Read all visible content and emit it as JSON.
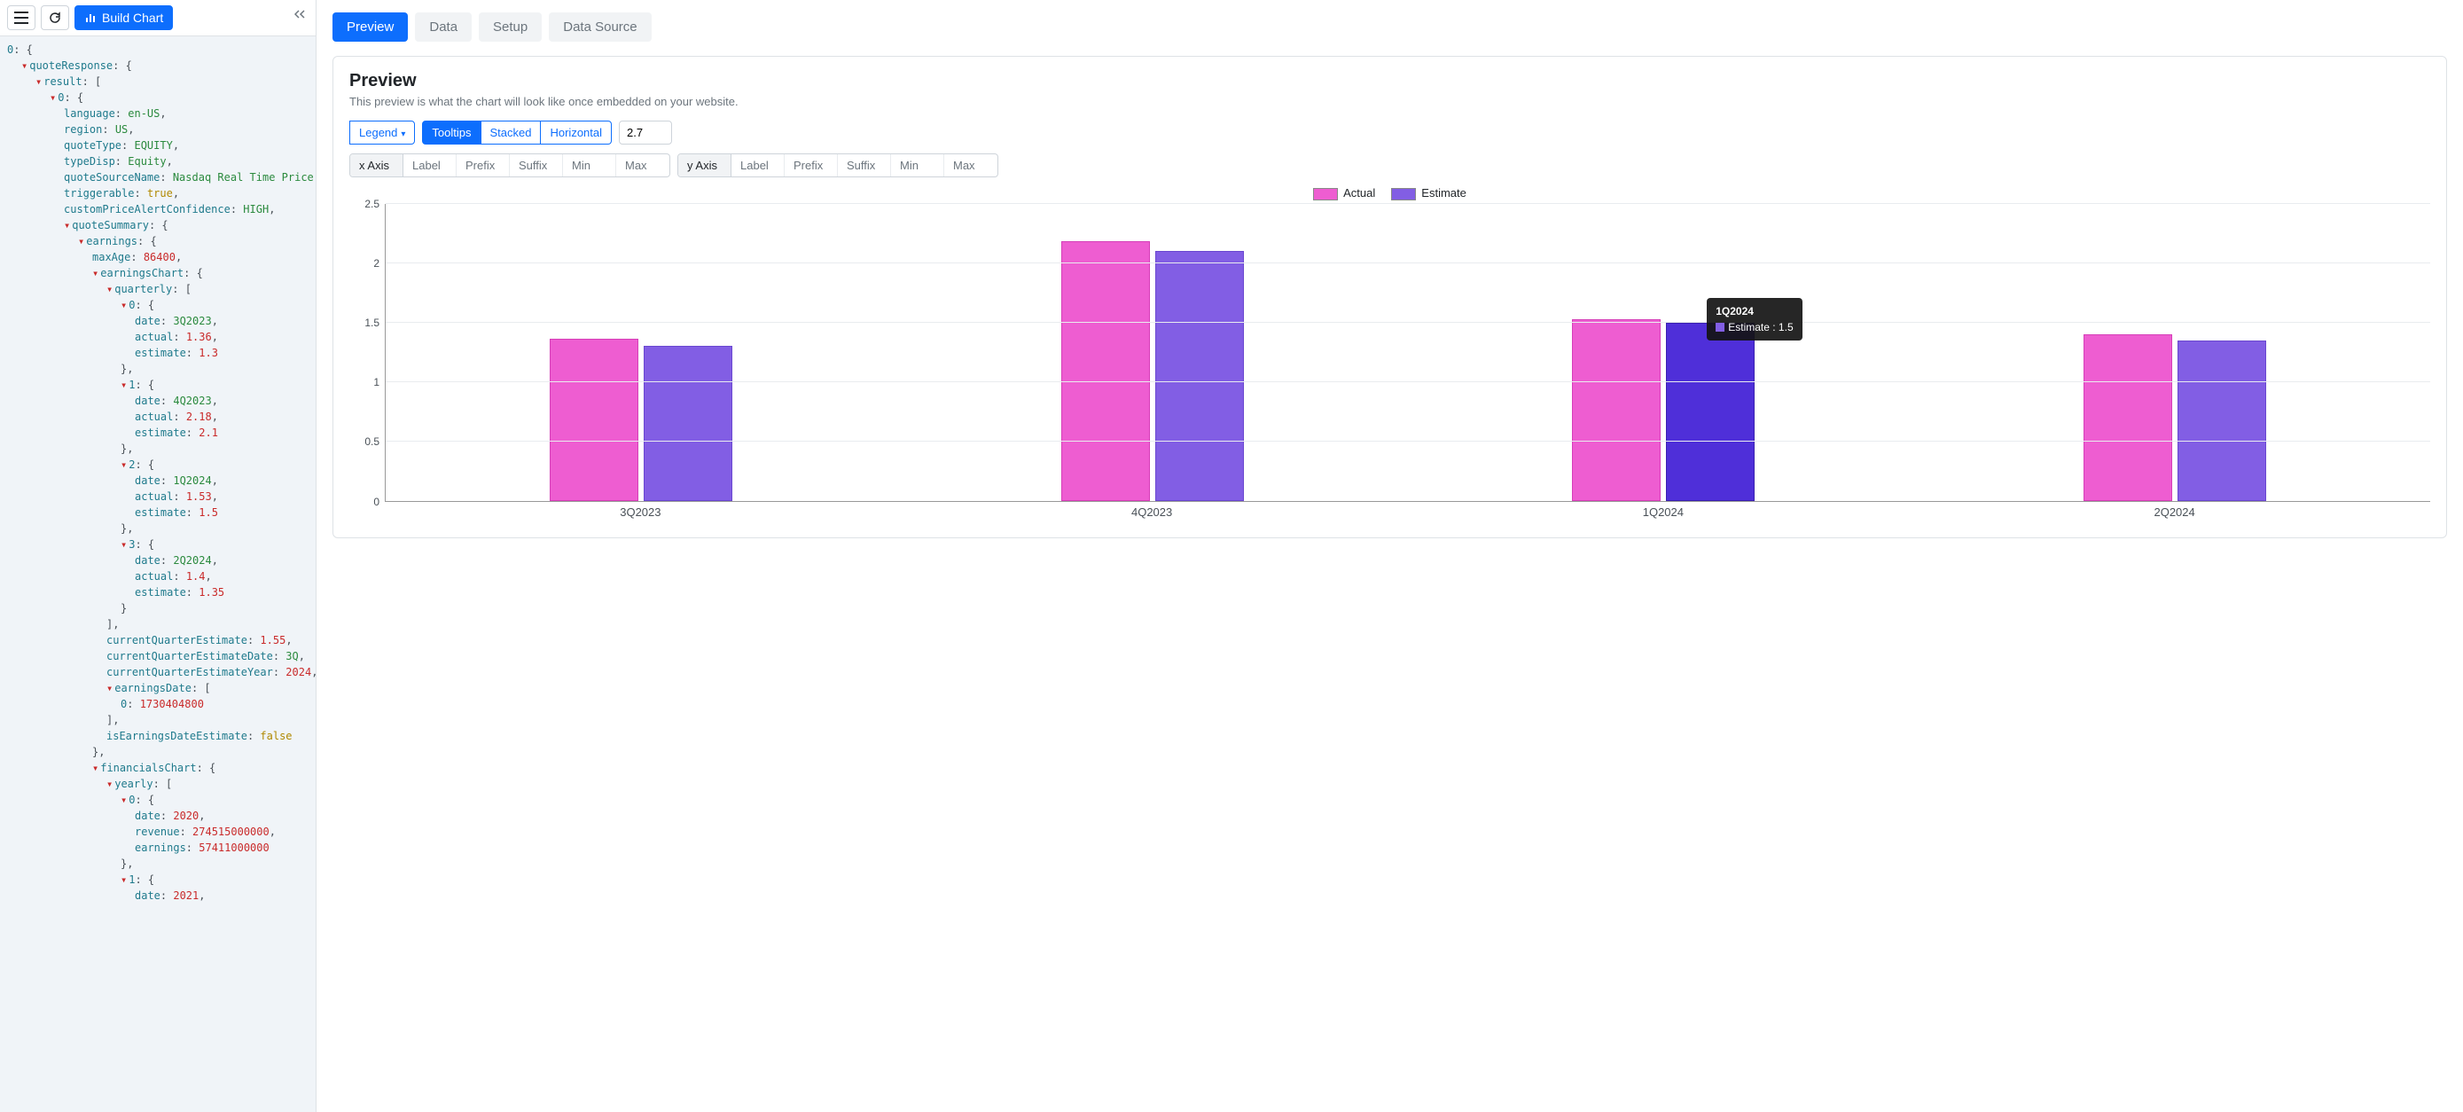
{
  "toolbar": {
    "build_label": "Build Chart"
  },
  "json_tree": {
    "quoteResponse": {
      "result0": {
        "language": "en-US",
        "region": "US",
        "quoteType": "EQUITY",
        "typeDisp": "Equity",
        "quoteSourceName": "Nasdaq Real Time Price",
        "triggerable": "true",
        "customPriceAlertConfidence": "HIGH",
        "quoteSummary": {
          "earnings": {
            "maxAge": "86400",
            "earningsChart": {
              "quarterly": [
                {
                  "date": "3Q2023",
                  "actual": "1.36",
                  "estimate": "1.3"
                },
                {
                  "date": "4Q2023",
                  "actual": "2.18",
                  "estimate": "2.1"
                },
                {
                  "date": "1Q2024",
                  "actual": "1.53",
                  "estimate": "1.5"
                },
                {
                  "date": "2Q2024",
                  "actual": "1.4",
                  "estimate": "1.35"
                }
              ],
              "currentQuarterEstimate": "1.55",
              "currentQuarterEstimateDate": "3Q",
              "currentQuarterEstimateYear": "2024",
              "earningsDate0": "1730404800",
              "isEarningsDateEstimate": "false"
            }
          },
          "financialsChart": {
            "yearly": [
              {
                "date": "2020",
                "revenue": "274515000000",
                "earnings": "57411000000"
              },
              {
                "date": "2021"
              }
            ]
          }
        }
      }
    }
  },
  "tabs": [
    "Preview",
    "Data",
    "Setup",
    "Data Source"
  ],
  "active_tab": 0,
  "preview": {
    "title": "Preview",
    "subtitle": "This preview is what the chart will look like once embedded on your website.",
    "legend_label": "Legend",
    "tooltips_label": "Tooltips",
    "stacked_label": "Stacked",
    "horizontal_label": "Horizontal",
    "ymax_input": "2.7",
    "axis_labels": {
      "xaxis": "x Axis",
      "yaxis": "y Axis",
      "label": "Label",
      "prefix": "Prefix",
      "suffix": "Suffix",
      "min": "Min",
      "max": "Max"
    }
  },
  "chart_data": {
    "type": "bar",
    "categories": [
      "3Q2023",
      "4Q2023",
      "1Q2024",
      "2Q2024"
    ],
    "series": [
      {
        "name": "Actual",
        "color": "#ee5dd1",
        "values": [
          1.36,
          2.18,
          1.53,
          1.4
        ]
      },
      {
        "name": "Estimate",
        "color": "#825ee4",
        "values": [
          1.3,
          2.1,
          1.5,
          1.35
        ]
      }
    ],
    "ylim": [
      0,
      2.5
    ],
    "grid_step": 0.5,
    "tooltip": {
      "category_index": 2,
      "series": "Estimate",
      "label": "1Q2024",
      "text": "Estimate : 1.5"
    }
  }
}
